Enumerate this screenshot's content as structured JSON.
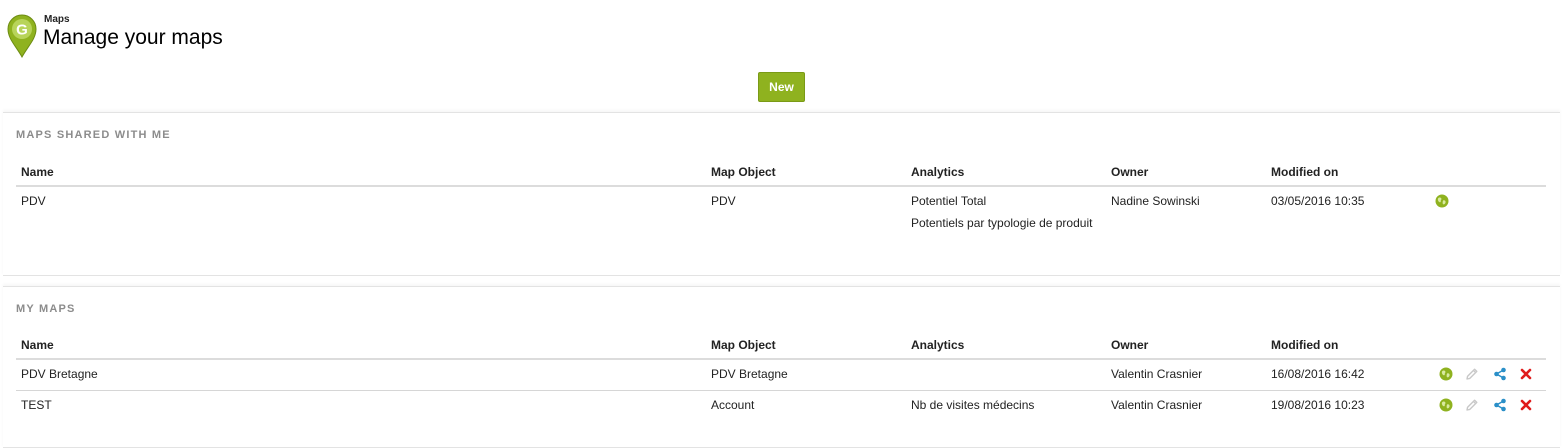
{
  "header": {
    "app_name": "Maps",
    "title": "Manage your maps",
    "logo_letter": "G"
  },
  "toolbar": {
    "new_label": "New"
  },
  "colors": {
    "accent_green": "#8fb21f",
    "share_blue": "#2a8fc8",
    "delete_red": "#e01b1b",
    "edit_gray": "#c8c8c8"
  },
  "columns": {
    "name": "Name",
    "map_object": "Map Object",
    "analytics": "Analytics",
    "owner": "Owner",
    "modified_on": "Modified on"
  },
  "shared_maps": {
    "title": "MAPS SHARED WITH ME",
    "rows": [
      {
        "name": "PDV",
        "map_object": "PDV",
        "analytics": [
          "Potentiel Total",
          "Potentiels par typologie de produit"
        ],
        "owner": "Nadine Sowinski",
        "modified_on": "03/05/2016 10:35",
        "actions": [
          "globe-icon"
        ]
      }
    ]
  },
  "my_maps": {
    "title": "MY MAPS",
    "rows": [
      {
        "name": "PDV Bretagne",
        "map_object": "PDV Bretagne",
        "analytics": "",
        "owner": "Valentin Crasnier",
        "modified_on": "16/08/2016 16:42",
        "actions": [
          "globe-icon",
          "pencil-icon",
          "share-icon",
          "delete-icon"
        ]
      },
      {
        "name": "TEST",
        "map_object": "Account",
        "analytics": "Nb de visites médecins",
        "owner": "Valentin Crasnier",
        "modified_on": "19/08/2016 10:23",
        "actions": [
          "globe-icon",
          "pencil-icon",
          "share-icon",
          "delete-icon"
        ]
      }
    ]
  }
}
